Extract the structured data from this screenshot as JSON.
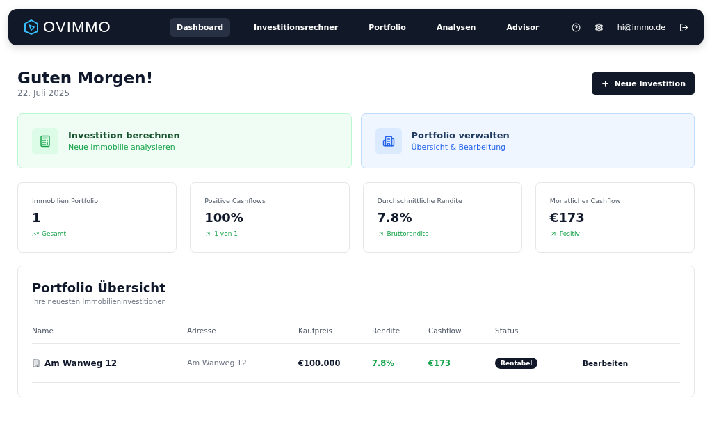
{
  "nav": {
    "logo": "OVIMMO",
    "tabs": [
      {
        "label": "Dashboard",
        "selected": true
      },
      {
        "label": "Investitionsrechner",
        "selected": false
      },
      {
        "label": "Portfolio",
        "selected": false
      },
      {
        "label": "Analysen",
        "selected": false
      },
      {
        "label": "Advisor",
        "selected": false
      }
    ],
    "email": "hi@immo.de"
  },
  "header": {
    "greeting": "Guten Morgen!",
    "date": "22. Juli 2025",
    "button": "Neue Investition"
  },
  "actions": [
    {
      "kind": "calculator",
      "title": "Investition berechnen",
      "subtitle": "Neue Immobilie analysieren"
    },
    {
      "kind": "building",
      "title": "Portfolio verwalten",
      "subtitle": "Übersicht & Bearbeitung"
    }
  ],
  "stats": [
    {
      "kind": "trend",
      "label": "Immobilien Portfolio",
      "value": "1",
      "note": "Gesamt"
    },
    {
      "kind": "arrow",
      "label": "Positive Cashflows",
      "value": "100%",
      "note": "1 von 1"
    },
    {
      "kind": "arrow",
      "label": "Durchschnittliche Rendite",
      "value": "7.8%",
      "note": "Bruttorendite"
    },
    {
      "kind": "arrow",
      "label": "Monatlicher Cashflow",
      "value": "€173",
      "note": "Positiv"
    }
  ],
  "table": {
    "title": "Portfolio Übersicht",
    "subtitle": "Ihre neuesten Immobilieninvestitionen",
    "columns": [
      "Name",
      "Adresse",
      "Kaufpreis",
      "Rendite",
      "Cashflow",
      "Status"
    ],
    "rows": [
      {
        "name": "Am Wanweg 12",
        "address": "Am Wanweg 12",
        "price": "€100.000",
        "yield": "7.8%",
        "cashflow": "€173",
        "status": "Rentabel",
        "action": "Bearbeiten"
      }
    ]
  }
}
